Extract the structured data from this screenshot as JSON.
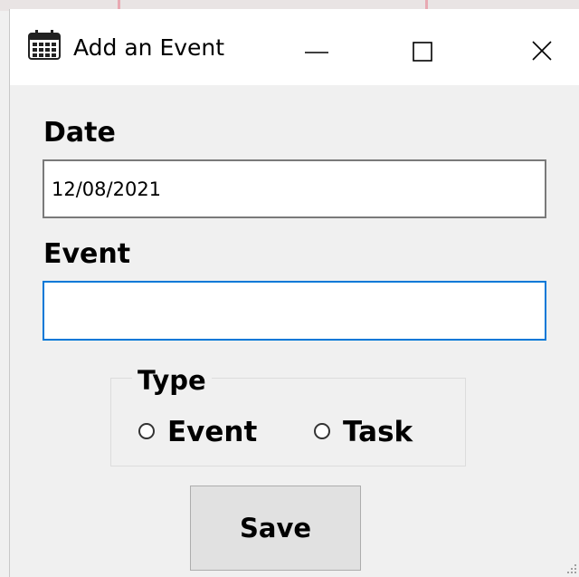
{
  "window": {
    "title": "Add an Event",
    "minimize_icon": "minimize-icon",
    "maximize_icon": "maximize-icon",
    "close_icon": "close-icon",
    "app_icon": "calendar-icon"
  },
  "form": {
    "date_label": "Date",
    "date_value": "12/08/2021",
    "event_label": "Event",
    "event_value": "",
    "type_group": {
      "legend": "Type",
      "options": [
        {
          "label": "Event",
          "selected": false
        },
        {
          "label": "Task",
          "selected": false
        }
      ]
    },
    "save_label": "Save"
  },
  "colors": {
    "focus_border": "#0078d7",
    "window_bg": "#f0f0f0",
    "titlebar_bg": "#ffffff",
    "button_bg": "#e1e1e1"
  }
}
